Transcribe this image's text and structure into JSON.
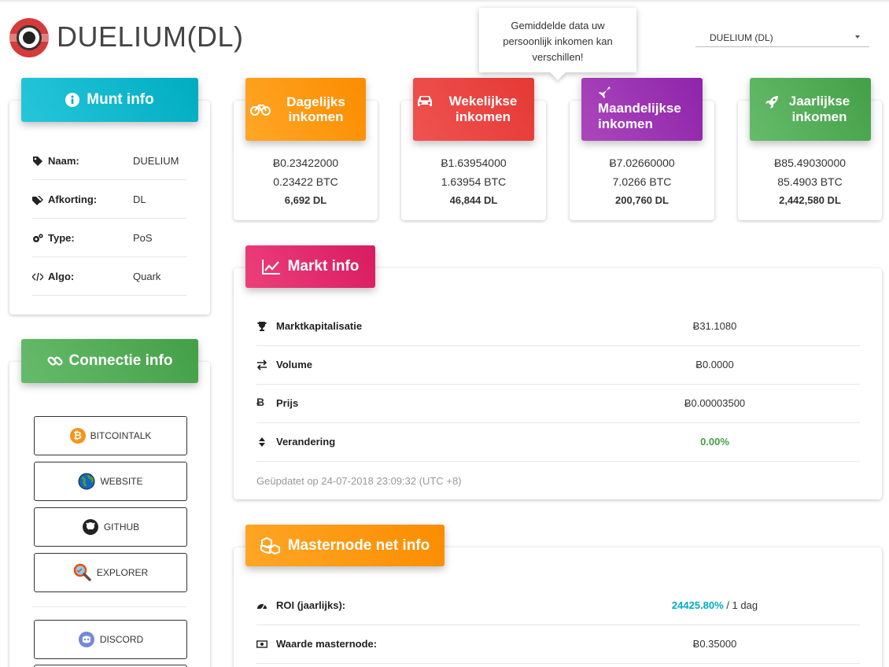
{
  "app": {
    "title": "DUELIUM(DL)"
  },
  "coin_select": {
    "value": "DUELIUM (DL)"
  },
  "tooltip": {
    "text": "Gemiddelde data uw persoonlijk inkomen kan verschillen!"
  },
  "munt_info": {
    "title": "Munt info",
    "rows": [
      {
        "label": "Naam:",
        "value": "DUELIUM",
        "icon": "tag-icon"
      },
      {
        "label": "Afkorting:",
        "value": "DL",
        "icon": "tags-icon"
      },
      {
        "label": "Type:",
        "value": "PoS",
        "icon": "cogs-icon"
      },
      {
        "label": "Algo:",
        "value": "Quark",
        "icon": "code-icon"
      }
    ]
  },
  "connectie_info": {
    "title": "Connectie info",
    "links": [
      {
        "label": "BITCOINTALK",
        "icon": "bitcoin-icon",
        "color": "#f7931a"
      },
      {
        "label": "WEBSITE",
        "icon": "globe-icon",
        "color": "#2e7d32"
      },
      {
        "label": "GITHUB",
        "icon": "github-icon",
        "color": "#222222"
      },
      {
        "label": "EXPLORER",
        "icon": "magnifier-icon",
        "color": "#e65100"
      },
      {
        "label": "DISCORD",
        "icon": "discord-icon",
        "color": "#7289da"
      }
    ]
  },
  "income": [
    {
      "title": "Dagelijks inkomen",
      "icon": "bicycle-icon",
      "btc_symbol": "Ƀ0.23422000",
      "btc": "0.23422 BTC",
      "coins": "6,692 DL"
    },
    {
      "title": "Wekelijkse inkomen",
      "icon": "car-icon",
      "btc_symbol": "Ƀ1.63954000",
      "btc": "1.63954 BTC",
      "coins": "46,844 DL"
    },
    {
      "title": "Maandelijkse inkomen",
      "icon": "plane-icon",
      "btc_symbol": "Ƀ7.02660000",
      "btc": "7.0266 BTC",
      "coins": "200,760 DL"
    },
    {
      "title": "Jaarlijkse inkomen",
      "icon": "rocket-icon",
      "btc_symbol": "Ƀ85.49030000",
      "btc": "85.4903 BTC",
      "coins": "2,442,580 DL"
    }
  ],
  "markt_info": {
    "title": "Markt info",
    "rows": [
      {
        "label": "Marktkapitalisatie",
        "value": "Ƀ31.1080",
        "icon": "trophy-icon"
      },
      {
        "label": "Volume",
        "value": "Ƀ0.0000",
        "icon": "exchange-icon"
      },
      {
        "label": "Prijs",
        "value": "Ƀ0.00003500",
        "icon": "btc-icon"
      },
      {
        "label": "Verandering",
        "value": "0.00%",
        "icon": "sort-icon"
      }
    ],
    "updated": "Geüpdatet op 24-07-2018 23:09:32 (UTC +8)"
  },
  "masternode_info": {
    "title": "Masternode net info",
    "rows": [
      {
        "label": "ROI  (jaarlijks):",
        "value_highlight": "24425.80%",
        "value_suffix": " / 1 dag",
        "icon": "dashboard-icon"
      },
      {
        "label": "Waarde masternode:",
        "value": "Ƀ0.35000",
        "icon": "money-icon"
      }
    ]
  },
  "colors": {
    "cyan": "#00acc1",
    "green": "#43a047",
    "orange": "#fb8c00",
    "red": "#e53935",
    "purple": "#8e24aa",
    "pink": "#d81b60"
  }
}
